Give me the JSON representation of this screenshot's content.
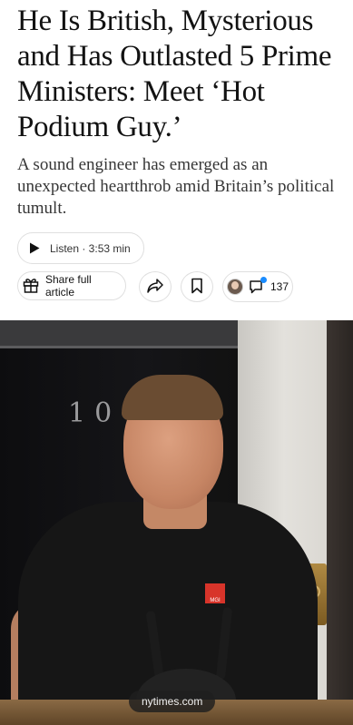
{
  "article": {
    "headline": "He Is British, Mysterious and Has Outlasted 5 Prime Ministers: Meet ‘Hot Podium Guy.’",
    "summary": "A sound engineer has emerged as an unexpected heartthrob amid Britain’s political tumult."
  },
  "listen": {
    "label": "Listen · 3:53 min",
    "icon": "play-icon"
  },
  "actions": {
    "share_full_label": "Share full article",
    "share_full_icon": "gift-icon",
    "share_icon": "share-arrow-icon",
    "save_icon": "bookmark-icon",
    "comments_count": "137",
    "comments_icon": "comment-bubble-icon"
  },
  "photo": {
    "door_number": "10",
    "badge_text": "MGI"
  },
  "browser": {
    "url": "nytimes.com"
  },
  "colors": {
    "text": "#121212",
    "summary_text": "#363636",
    "border": "#dfdfdf",
    "notification_dot": "#1a8cff"
  }
}
